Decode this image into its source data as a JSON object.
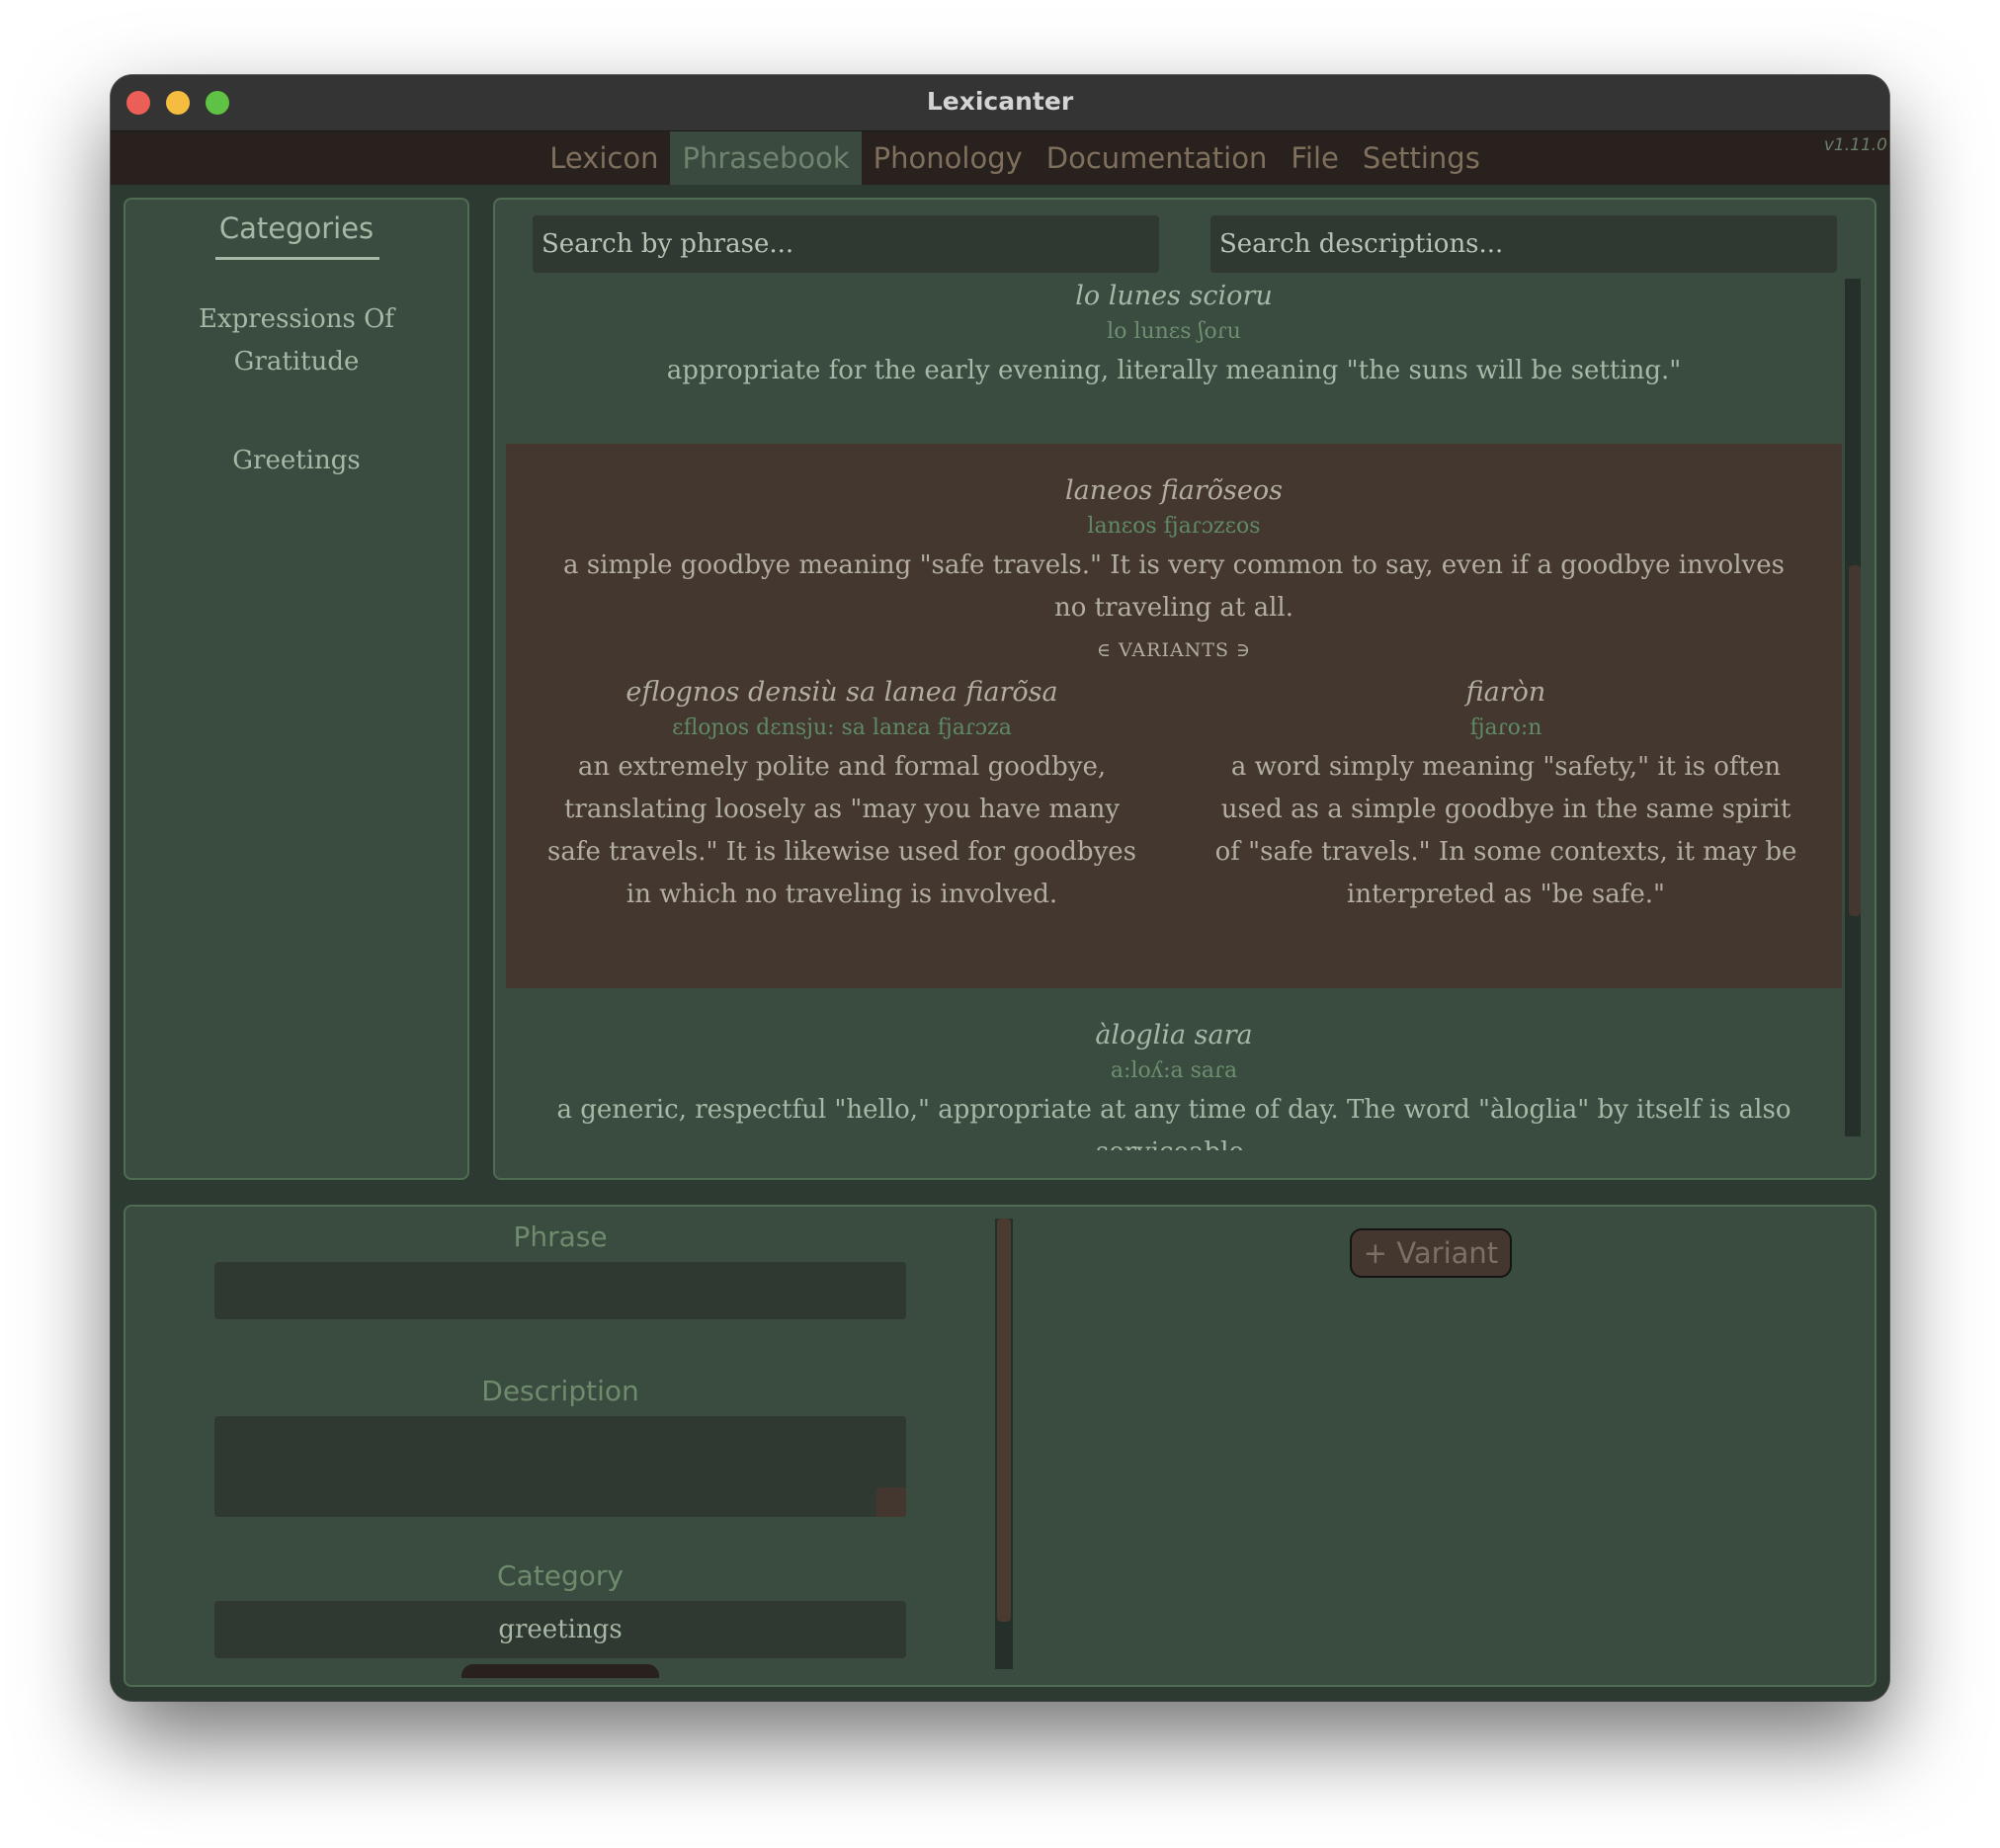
{
  "window": {
    "title": "Lexicanter",
    "version": "v1.11.0"
  },
  "menu": {
    "items": [
      {
        "label": "Lexicon"
      },
      {
        "label": "Phrasebook",
        "active": true
      },
      {
        "label": "Phonology"
      },
      {
        "label": "Documentation"
      },
      {
        "label": "File"
      },
      {
        "label": "Settings"
      }
    ]
  },
  "categories": {
    "heading": "Categories",
    "items": [
      {
        "label": "Expressions Of Gratitude"
      },
      {
        "label": "Greetings"
      }
    ]
  },
  "search": {
    "phrase_placeholder": "Search by phrase...",
    "description_placeholder": "Search descriptions..."
  },
  "entries": [
    {
      "phrase": "lo lunes scioru",
      "pronunciation": "lo lunɛs ʃoɾu",
      "description": "appropriate for the early evening, literally meaning \"the suns will be setting.\""
    },
    {
      "phrase": "laneos fiarõseos",
      "pronunciation": "lanɛos fjaɾɔzɛos",
      "description": "a simple goodbye meaning \"safe travels.\" It is very common to say, even if a goodbye involves no traveling at all.",
      "variants_label": "∈ VARIANTS ∋",
      "variants": [
        {
          "phrase": "eflognos densiù sa lanea fiarõsa",
          "pronunciation": "ɛfloɲos dɛnsju: sa lanɛa fjaɾɔza",
          "description": "an extremely polite and formal goodbye, translating loosely as \"may you have many safe travels.\" It is likewise used for goodbyes in which no traveling is involved."
        },
        {
          "phrase": "fiaròn",
          "pronunciation": "fjaɾo:n",
          "description": "a word simply meaning \"safety,\" it is often used as a simple goodbye in the same spirit of \"safe travels.\" In some contexts, it may be interpreted as \"be safe.\""
        }
      ]
    },
    {
      "phrase": "àloglia sara",
      "pronunciation": "a:loʎ:a saɾa",
      "description": "a generic, respectful \"hello,\" appropriate at any time of day. The word \"àloglia\" by itself is also serviceable."
    }
  ],
  "editor": {
    "phrase_label": "Phrase",
    "phrase_value": "",
    "description_label": "Description",
    "description_value": "",
    "category_label": "Category",
    "category_value": "greetings",
    "add_variant_label": "+ Variant"
  },
  "colors": {
    "background": "#2d3a31",
    "panel": "#3a4b3f",
    "panel_border": "#4f6b52",
    "selected_entry": "#44372f",
    "text": "#a7b9a6",
    "muted_text": "#6d8f6f",
    "menu_text": "#7f705d"
  }
}
